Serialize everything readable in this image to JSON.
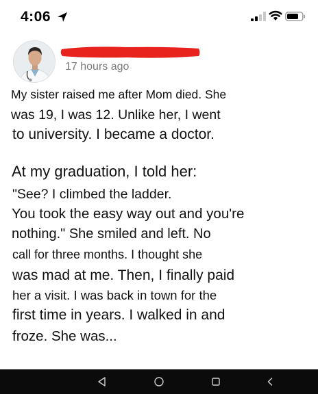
{
  "status_bar": {
    "time": "4:06",
    "icons": [
      "location-arrow-icon",
      "cellular-signal-icon",
      "wifi-icon",
      "battery-icon"
    ]
  },
  "post": {
    "avatar": "doctor-avatar",
    "author_redaction_color": "#e8231d",
    "timestamp": "17 hours ago",
    "lines": [
      "My sister raised me after Mom died. She",
      "was 19, I was 12. Unlike her, I went",
      "to university. I became a doctor.",
      "At my graduation, I told her:",
      "\"See? I climbed the ladder.",
      "You took the easy way out and you're",
      "nothing.\" She smiled and left. No",
      "call for three months. I thought she",
      "was mad at me. Then, I finally paid",
      "her a visit. I was back in town for the",
      "first time in years. I walked in and",
      "froze. She was..."
    ]
  },
  "nav_bar": {
    "background": "#0b0b0b",
    "buttons": [
      "back-triangle-icon",
      "home-circle-icon",
      "recents-square-icon",
      "collapse-chevron-icon"
    ]
  }
}
